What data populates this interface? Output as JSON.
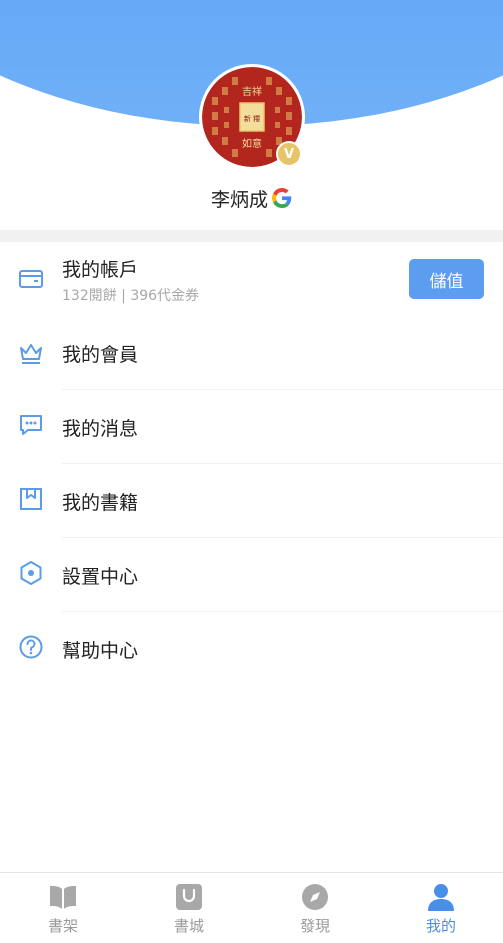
{
  "profile": {
    "name": "李炳成",
    "vip_badge": "V",
    "avatar_text": {
      "center": "新 糧",
      "top": "吉祥",
      "bottom": "如意"
    }
  },
  "menu": {
    "account": {
      "label": "我的帳戶",
      "subtitle": "132閱餅 | 396代金券",
      "button_label": "儲值"
    },
    "items": [
      {
        "label": "我的會員",
        "icon": "crown-icon"
      },
      {
        "label": "我的消息",
        "icon": "message-icon"
      },
      {
        "label": "我的書籍",
        "icon": "bookmark-icon"
      },
      {
        "label": "設置中心",
        "icon": "settings-icon"
      },
      {
        "label": "幫助中心",
        "icon": "help-icon"
      }
    ]
  },
  "tabbar": {
    "items": [
      {
        "label": "書架",
        "icon": "bookshelf-icon",
        "active": false
      },
      {
        "label": "書城",
        "icon": "store-bag-icon",
        "active": false
      },
      {
        "label": "發現",
        "icon": "compass-icon",
        "active": false
      },
      {
        "label": "我的",
        "icon": "user-icon",
        "active": true
      }
    ]
  },
  "colors": {
    "accent": "#4a8fe7",
    "header_gradient_top": "#4d94ee",
    "header_gradient_bottom": "#6fb0f8",
    "button": "#5d9df0",
    "icon": "#5b9ce8",
    "inactive": "#9a9a9a",
    "avatar_red": "#b3261e",
    "avatar_gold": "#e9c46a"
  }
}
